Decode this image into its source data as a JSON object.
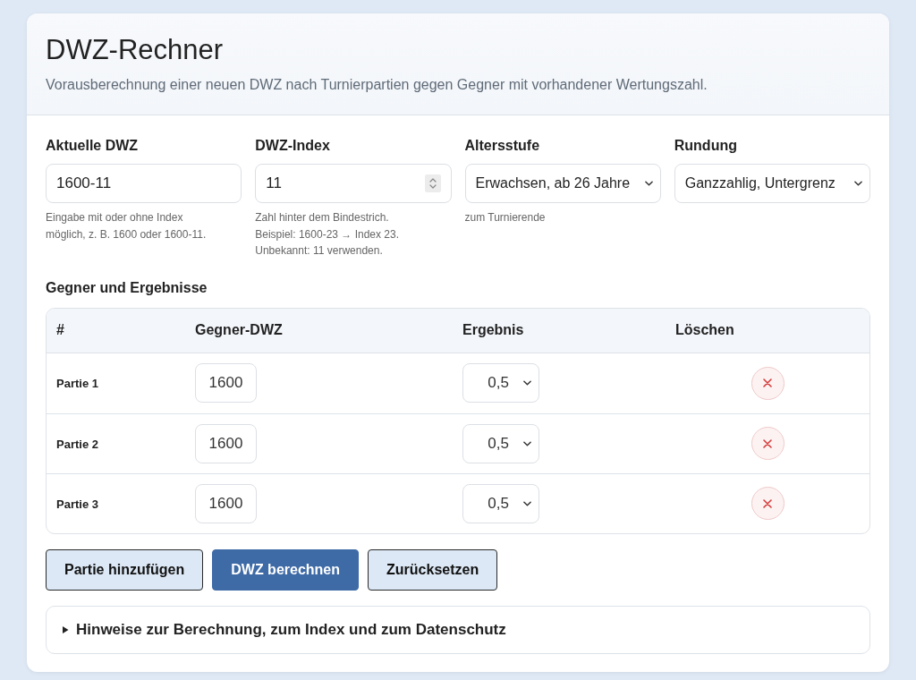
{
  "header": {
    "title": "DWZ-Rechner",
    "subtitle": "Vorausberechnung einer neuen DWZ nach Turnierpartien gegen Gegner mit vorhandener Wertungszahl."
  },
  "fields": [
    {
      "kind": "text",
      "label": "Aktuelle DWZ",
      "value": "1600-11",
      "hint": [
        "Eingabe mit oder ohne Index",
        "möglich, z. B. 1600 oder 1600-11."
      ]
    },
    {
      "kind": "number",
      "label": "DWZ-Index",
      "value": "11",
      "hint": [
        "Zahl hinter dem Bindestrich.",
        "Beispiel: 1600-23 → Index 23.",
        "Unbekannt: 11 verwenden."
      ]
    },
    {
      "kind": "select",
      "label": "Altersstufe",
      "value": "Erwachsen, ab 26 Jahre",
      "hint": [
        "zum Turnierende"
      ]
    },
    {
      "kind": "select",
      "label": "Rundung",
      "value": "Ganzzahlig, Untergrenz"
    }
  ],
  "games": {
    "title": "Gegner und Ergebnisse",
    "columns": [
      "#",
      "Gegner-DWZ",
      "Ergebnis",
      "Löschen"
    ],
    "rows": [
      {
        "label": "Partie 1",
        "opponent": "1600",
        "result": "0,5"
      },
      {
        "label": "Partie 2",
        "opponent": "1600",
        "result": "0,5"
      },
      {
        "label": "Partie 3",
        "opponent": "1600",
        "result": "0,5"
      }
    ]
  },
  "buttons": [
    {
      "label": "Partie hinzufügen",
      "kind": "secondary"
    },
    {
      "label": "DWZ berechnen",
      "kind": "primary"
    },
    {
      "label": "Zurücksetzen",
      "kind": "secondary"
    }
  ],
  "details": {
    "summary": "Hinweise zur Berechnung, zum Index und zum Datenschutz",
    "expanded": false
  }
}
